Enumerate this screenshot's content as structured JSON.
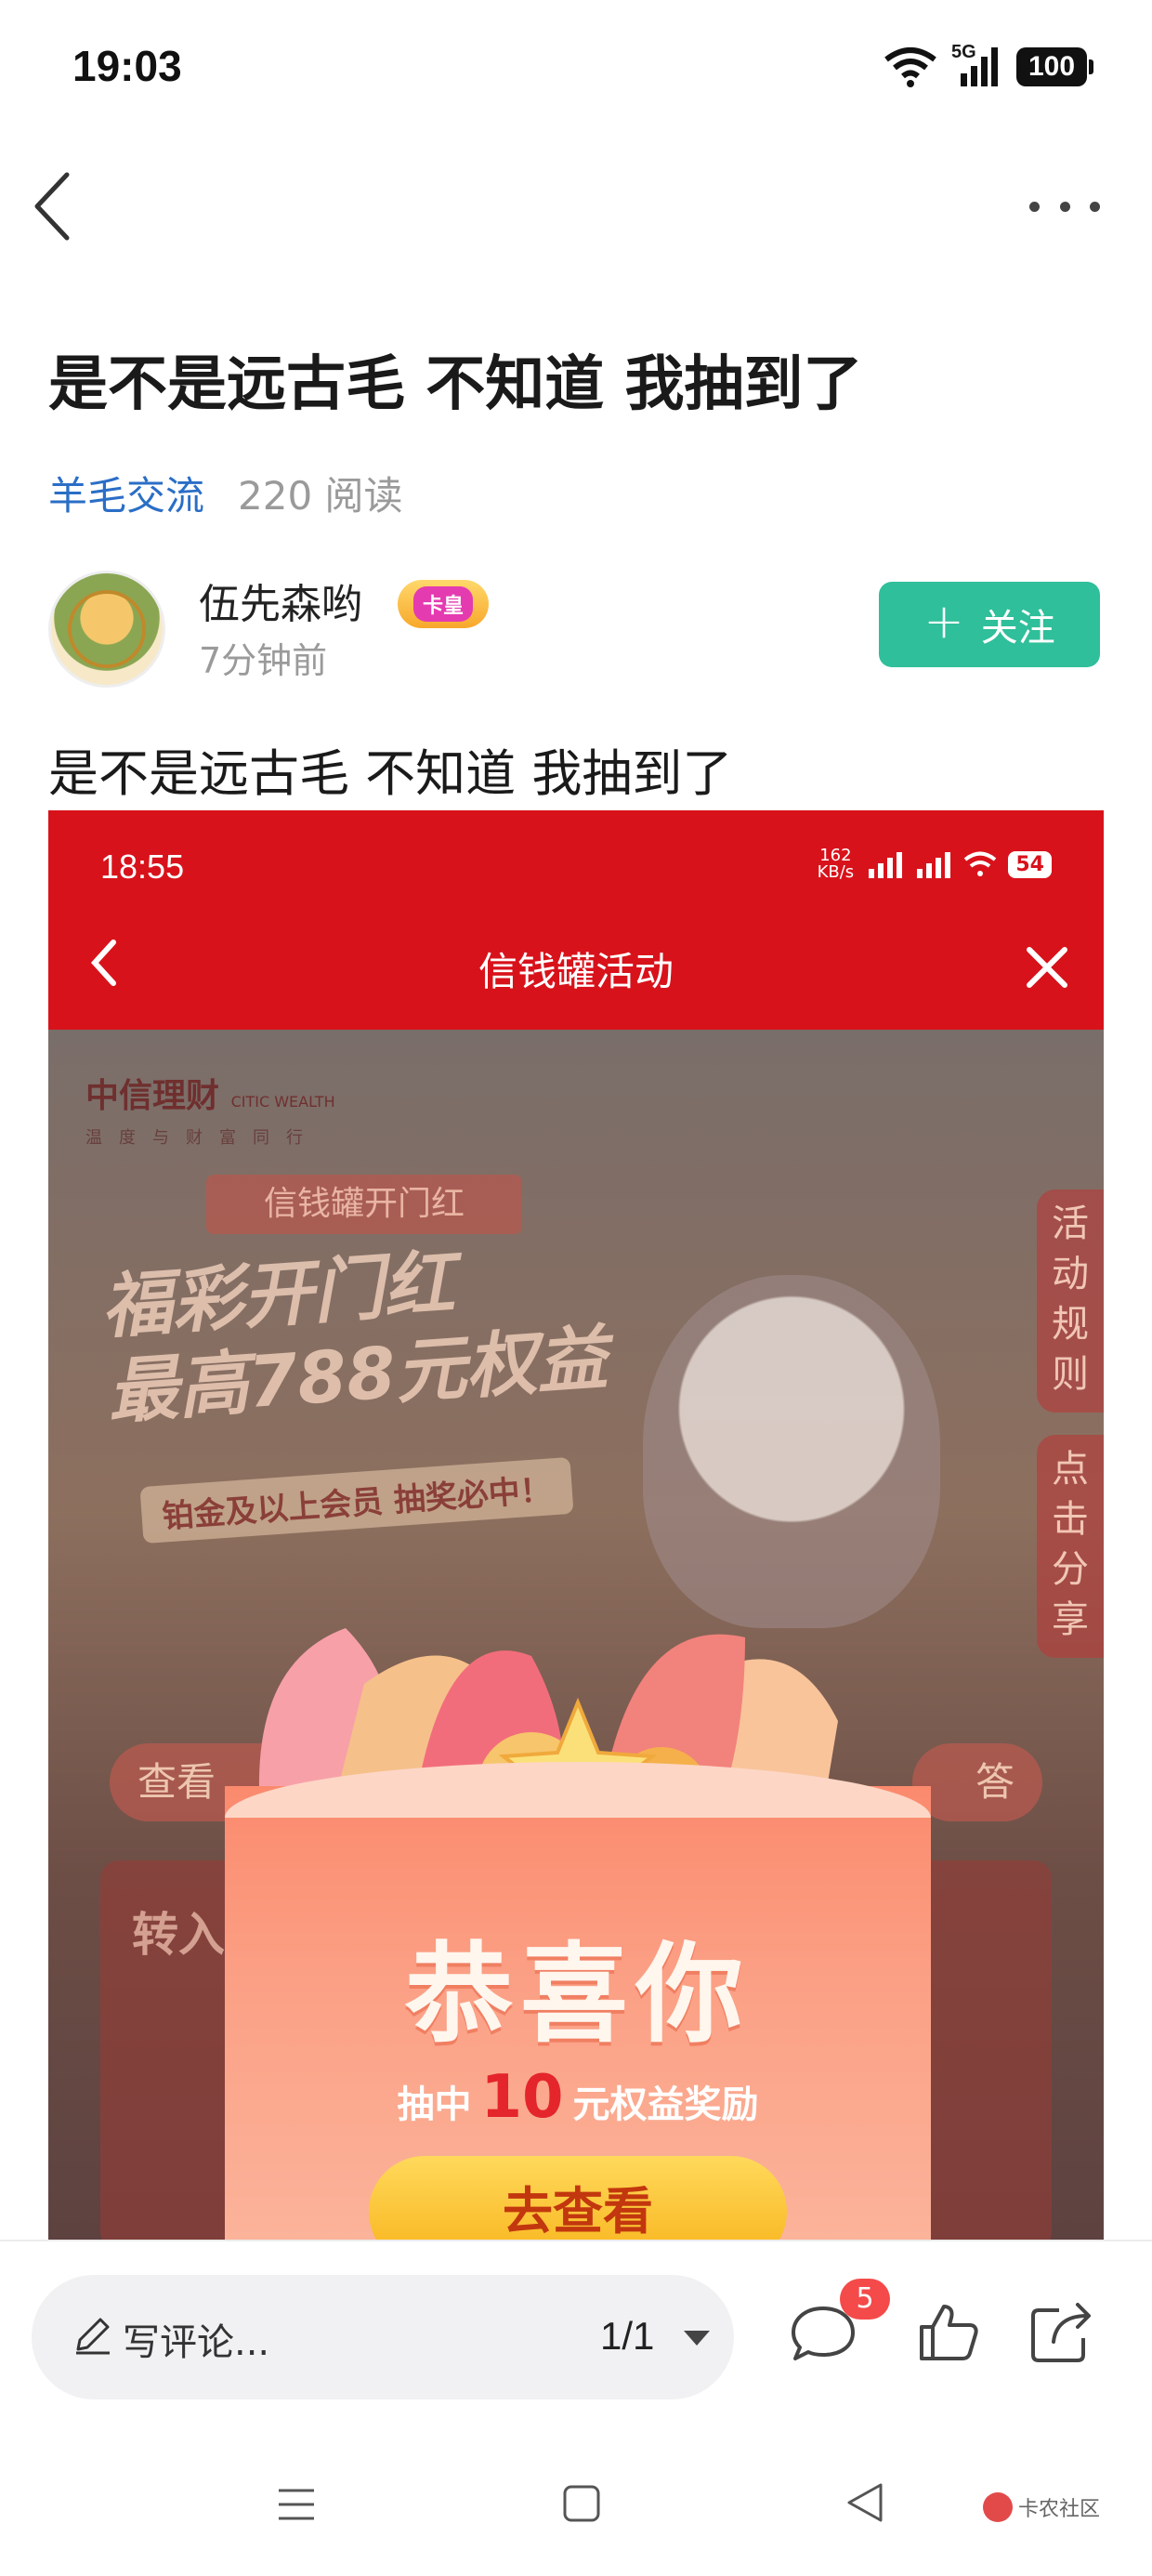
{
  "status_bar": {
    "time": "19:03",
    "network": "5G",
    "battery": "100"
  },
  "post": {
    "title": "是不是远古毛 不知道 我抽到了",
    "category": "羊毛交流",
    "reads": "220 阅读",
    "body_text": "是不是远古毛 不知道 我抽到了"
  },
  "author": {
    "name": "伍先森哟",
    "badge": "卡皇",
    "time": "7分钟前",
    "follow_label": "关注"
  },
  "embedded_screenshot": {
    "time": "18:55",
    "net_speed": "162 KB/s",
    "battery": "54",
    "title": "信钱罐活动",
    "brand": "中信理财",
    "brand_en": "CITIC WEALTH",
    "slogan": "温度与财富同行",
    "promo_tag": "信钱罐开门红",
    "headline_line1": "福彩开门红",
    "headline_line2": "最高788元权益",
    "headline_sub": "铂金及以上会员 抽奖必中！",
    "side_rules": "活动规则",
    "side_share": "点击分享",
    "cta_left": "查看",
    "cta_right": "答",
    "card_title": "转入",
    "prize_title": "恭喜你",
    "prize_prefix": "抽中",
    "prize_amount": "10",
    "prize_suffix": "元权益奖励",
    "prize_button": "去查看"
  },
  "bottom_bar": {
    "comment_placeholder": "写评论...",
    "page_indicator": "1/1",
    "comment_count": "5"
  },
  "watermark": "卡农社区",
  "colors": {
    "accent_green": "#2fbf9a",
    "link_blue": "#2a6ec6",
    "embed_red": "#d8121b",
    "badge_red": "#f44a4a"
  }
}
